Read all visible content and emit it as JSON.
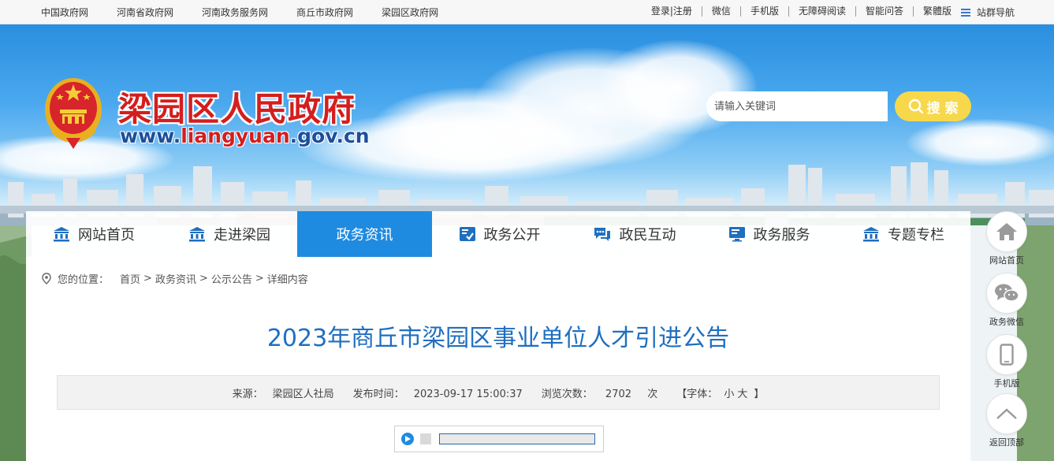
{
  "top_links": [
    "中国政府网",
    "河南省政府网",
    "河南政务服务网",
    "商丘市政府网",
    "梁园区政府网"
  ],
  "top_right_links": [
    "登录|注册",
    "微信",
    "手机版",
    "无障碍阅读",
    "智能问答",
    "繁體版"
  ],
  "site_nav_label": "站群导航",
  "site": {
    "name": "梁园区人民政府",
    "domain_prefix": "www.",
    "domain_highlight": "liangyuan",
    "domain_suffix": ".gov.cn"
  },
  "search": {
    "placeholder": "请输入关键词",
    "button_label": "搜 索"
  },
  "nav": [
    {
      "label": "网站首页",
      "icon": "bank-icon",
      "active": false
    },
    {
      "label": "走进梁园",
      "icon": "bank-icon",
      "active": false
    },
    {
      "label": "政务资讯",
      "icon": "",
      "active": true
    },
    {
      "label": "政务公开",
      "icon": "document-check-icon",
      "active": false
    },
    {
      "label": "政民互动",
      "icon": "chat-icon",
      "active": false
    },
    {
      "label": "政务服务",
      "icon": "monitor-icon",
      "active": false
    },
    {
      "label": "专题专栏",
      "icon": "bank-icon",
      "active": false
    }
  ],
  "breadcrumb": {
    "position_label": "您的位置：",
    "items": [
      "首页",
      "政务资讯",
      "公示公告",
      "详细内容"
    ],
    "separator": ">"
  },
  "article": {
    "title": "2023年商丘市梁园区事业单位人才引进公告",
    "source_label": "来源：",
    "source": "梁园区人社局",
    "published_label": "发布时间：",
    "published": "2023-09-17 15:00:37",
    "views_label": "浏览次数：",
    "views": "2702",
    "views_unit": "次",
    "font_size_prefix": "【字体：",
    "font_small": "小",
    "font_large": "大",
    "font_size_suffix": "】"
  },
  "audio_player": {
    "progress_fraction": 0
  },
  "float_bar": [
    "网站首页",
    "政务微信",
    "手机版",
    "返回顶部"
  ],
  "colors": {
    "accent_blue": "#1f8be0",
    "title_blue": "#1f6fc0",
    "brand_red": "#d41e1e",
    "domain_blue": "#1c4f9a",
    "search_yellow": "#f7d84b"
  }
}
